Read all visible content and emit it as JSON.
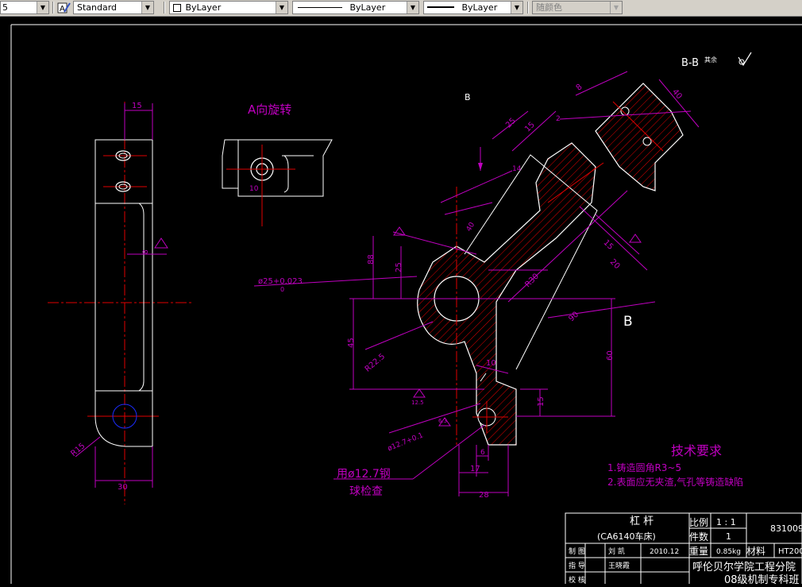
{
  "toolbar": {
    "layer_fragment": "5",
    "text_style": "Standard",
    "color_label": "ByLayer",
    "linetype_label": "ByLayer",
    "lineweight_label": "ByLayer",
    "plot_style": "随颜色",
    "icon": "text-style-icon"
  },
  "drawing": {
    "view_a_title": "A向旋转",
    "section_label": "B-B",
    "section_suffix": "其余",
    "b_marker_top": "B",
    "b_marker_right": "B",
    "note_ball_line1": "用ø12.7钢",
    "note_ball_line2": "球检查",
    "tech_req_title": "技术要求",
    "tech_req_1": "1.铸造圆角R3~5",
    "tech_req_2": "2.表面应无夹渣,气孔等铸造缺陷",
    "dims": {
      "d15_top": "15",
      "d30_bottom": "30",
      "r15": "R15",
      "d8_left": "8",
      "d10_view_a": "10",
      "dia25": "ø25+0.023",
      "dia25_lower": "0",
      "d25": "25",
      "d88": "88",
      "d45": "45",
      "r22_5": "R22.5",
      "d60": "60",
      "d90": "90",
      "d15_right": "15",
      "d10_mid": "10",
      "d17": "17",
      "d28": "28",
      "d6": "6",
      "dia12_7": "ø12.7+0.1",
      "r30": "R30",
      "d20": "20",
      "d15_b": "15",
      "d25_top": "25",
      "d15_top2": "15",
      "d2": "2",
      "d8_top": "8",
      "d40": "40",
      "d14": "14",
      "d40_b": "40",
      "d12_5": "12.5",
      "d6_3": "6.3"
    }
  },
  "title_block": {
    "part_name": "杠    杆",
    "part_sub": "(CA6140车床)",
    "scale_label": "比例",
    "scale_value": "1 : 1",
    "qty_label": "件数",
    "qty_value": "1",
    "drawing_no": "831009",
    "weight_label": "重量",
    "weight_value": "0.85kg",
    "material_label": "材料",
    "material_value": "HT200",
    "row1_role": "制  图",
    "row1_name": "刘  凯",
    "row1_date": "2010.12",
    "row2_role": "指  导",
    "row2_name": "王晓霞",
    "row3_role": "校  核",
    "school": "呼伦贝尔学院工程分院",
    "class": "08级机制专科班"
  }
}
